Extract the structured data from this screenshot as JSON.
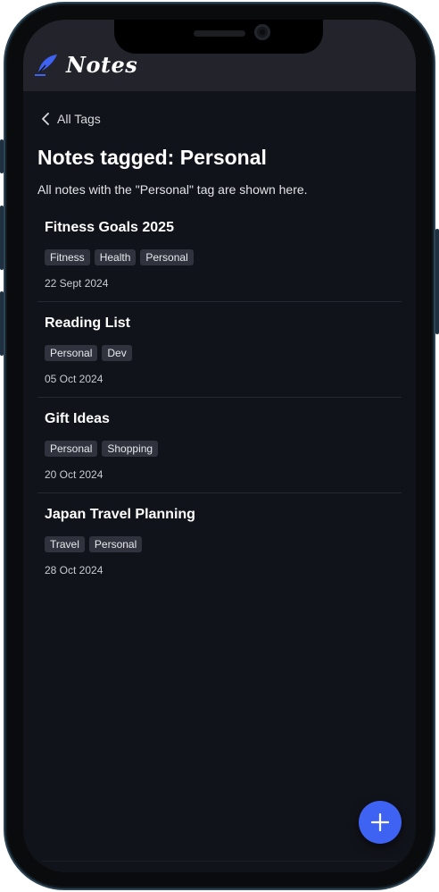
{
  "app": {
    "title": "Notes",
    "brand_icon": "feather-pen-icon",
    "accent_color": "#3e63f2"
  },
  "navigation": {
    "back_label": "All Tags",
    "back_icon": "chevron-left-icon"
  },
  "page": {
    "title": "Notes tagged: Personal",
    "subtitle": "All notes with the \"Personal\" tag are shown here."
  },
  "notes": [
    {
      "title": "Fitness Goals 2025",
      "tags": [
        "Fitness",
        "Health",
        "Personal"
      ],
      "date": "22 Sept 2024"
    },
    {
      "title": "Reading List",
      "tags": [
        "Personal",
        "Dev"
      ],
      "date": "05 Oct 2024"
    },
    {
      "title": "Gift Ideas",
      "tags": [
        "Personal",
        "Shopping"
      ],
      "date": "20 Oct 2024"
    },
    {
      "title": "Japan Travel Planning",
      "tags": [
        "Travel",
        "Personal"
      ],
      "date": "28 Oct 2024"
    }
  ],
  "fab": {
    "icon": "plus-icon"
  }
}
